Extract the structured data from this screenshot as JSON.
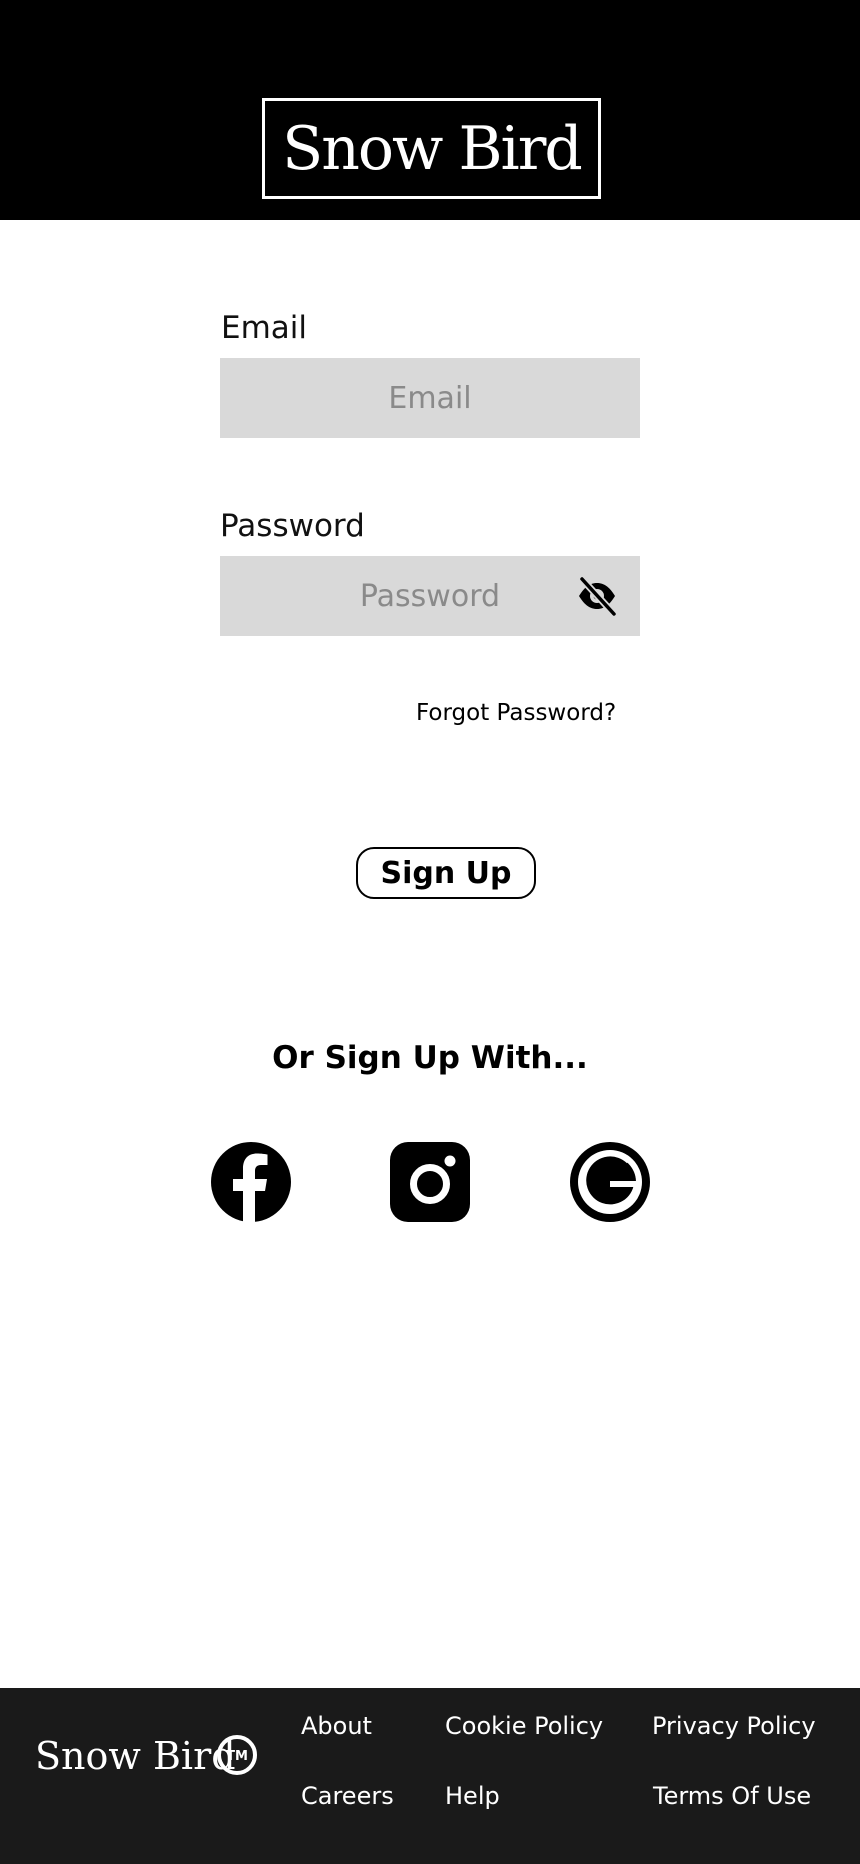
{
  "header": {
    "logo_text": "Snow Bird"
  },
  "form": {
    "email_label": "Email",
    "email_placeholder": "Email",
    "email_value": "",
    "password_label": "Password",
    "password_placeholder": "Password",
    "password_value": "",
    "forgot_password": "Forgot Password?",
    "signup_button": "Sign Up"
  },
  "social": {
    "heading": "Or Sign Up With...",
    "providers": [
      "facebook",
      "instagram",
      "google"
    ]
  },
  "footer": {
    "logo_text": "Snow Bird",
    "trademark": "TM",
    "links": [
      "About",
      "Cookie Policy",
      "Privacy Policy",
      "Careers",
      "Help",
      "Terms Of Use"
    ]
  },
  "colors": {
    "header_bg": "#000000",
    "footer_bg": "#1a1a1a",
    "input_bg": "#d9d9d9",
    "placeholder": "#8a8a8a"
  }
}
